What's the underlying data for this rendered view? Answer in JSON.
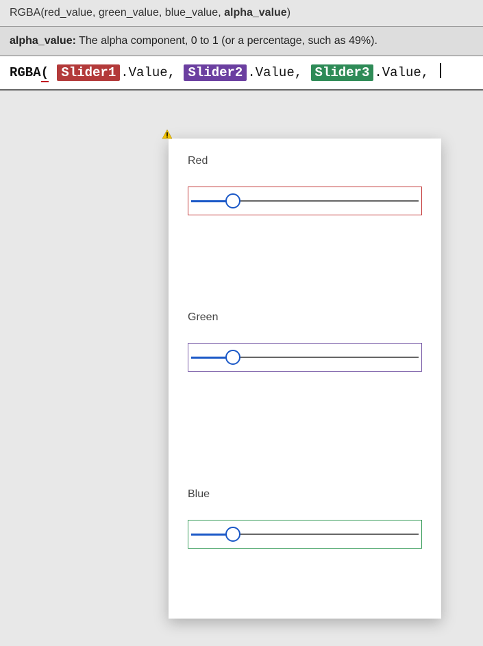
{
  "signature": {
    "func": "RGBA",
    "args_display": "(red_value, green_value, blue_value, ",
    "highlighted_arg": "alpha_value",
    "close": ")"
  },
  "arg_help": {
    "name": "alpha_value:",
    "desc": " The alpha component, 0 to 1 (or a percentage, such as 49%)."
  },
  "formula": {
    "func": "RGBA",
    "open": "(",
    "slider1": "Slider1",
    "slider2": "Slider2",
    "slider3": "Slider3",
    "prop": ".Value",
    "comma": ", "
  },
  "sliders": {
    "red": {
      "label": "Red",
      "percent": 18,
      "border_color": "#c43b3b"
    },
    "green": {
      "label": "Green",
      "percent": 18,
      "border_color": "#7a5da8"
    },
    "blue": {
      "label": "Blue",
      "percent": 18,
      "border_color": "#3a9d5c"
    }
  },
  "icons": {
    "warning": "warning-icon"
  }
}
